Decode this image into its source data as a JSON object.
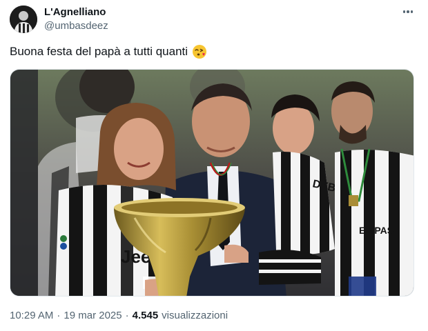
{
  "author": {
    "display_name": "L'Agnelliano",
    "handle": "@umbasdeez"
  },
  "menu": {
    "icon": "more-horizontal-icon"
  },
  "tweet": {
    "text": "Buona festa del papà a tutti quanti",
    "emoji": "face-blowing-a-kiss-emoji"
  },
  "photo": {
    "shirt_text": "Jeep",
    "kid_shirt_text": "DYB",
    "right_shirt_text": "EP PASS"
  },
  "meta": {
    "time": "10:29 AM",
    "separator": "·",
    "date": "19 mar 2025",
    "views_count": "4.545",
    "views_label": "visualizzazioni"
  },
  "colors": {
    "text_primary": "#0f1419",
    "text_secondary": "#536471",
    "trophy_gold": "#a89039"
  }
}
